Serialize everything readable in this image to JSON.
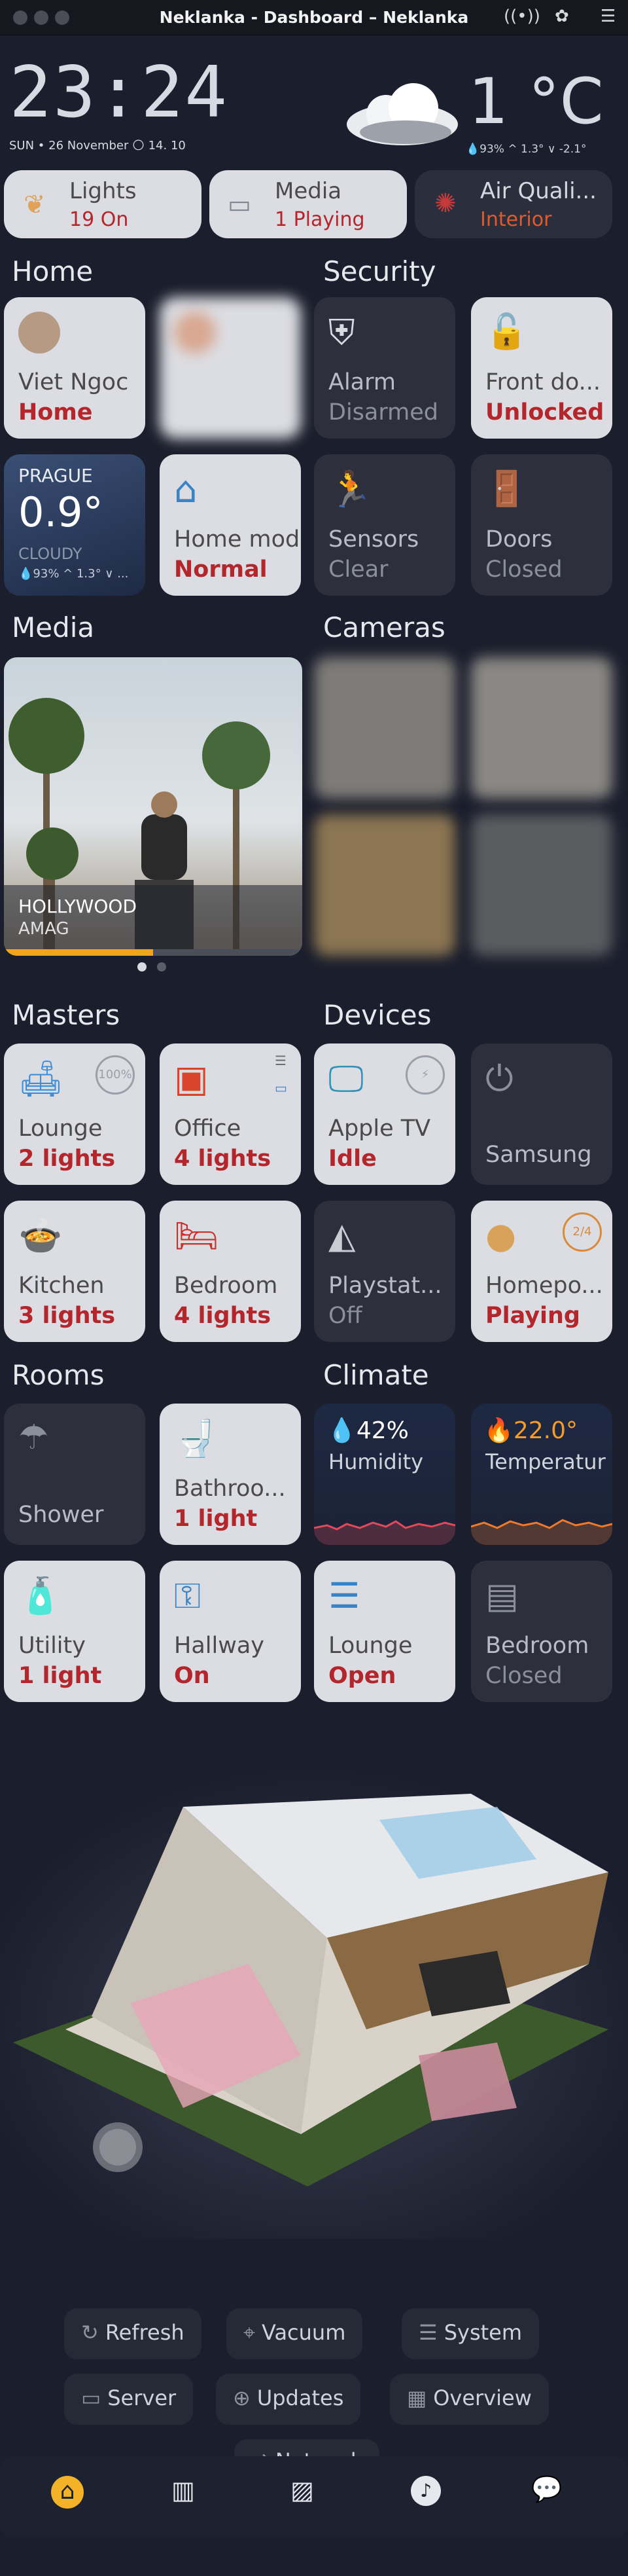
{
  "window": {
    "title": "Neklanka - Dashboard – Neklanka"
  },
  "header": {
    "time": "23:24",
    "date": "SUN • 26 November 🌕 14. 10",
    "temperature": "1 °C",
    "temp_details": "💧93% ^ 1.3° ∨ -2.1°"
  },
  "top_pills": [
    {
      "label": "Lights",
      "status": "19 On"
    },
    {
      "label": "Media",
      "status": "1 Playing"
    },
    {
      "label": "Air Quali...",
      "status": "Interior"
    }
  ],
  "sections": {
    "home": "Home",
    "security": "Security",
    "media": "Media",
    "cameras": "Cameras",
    "masters": "Masters",
    "devices": "Devices",
    "rooms": "Rooms",
    "climate": "Climate"
  },
  "home_cards": {
    "person1_name": "Viet Ngoc",
    "person1_state": "Home",
    "weather_city": "PRAGUE",
    "weather_temp": "0.9°",
    "weather_cond": "CLOUDY",
    "weather_details": "💧93% ^ 1.3° ∨ ...",
    "home_mode_name": "Home mode",
    "home_mode_state": "Normal"
  },
  "security_cards": [
    {
      "name": "Alarm",
      "state": "Disarmed"
    },
    {
      "name": "Front do...",
      "state": "Unlocked"
    },
    {
      "name": "Sensors",
      "state": "Clear"
    },
    {
      "name": "Doors",
      "state": "Closed"
    }
  ],
  "media_player": {
    "title": "HOLLYWOOD",
    "artist": "AMAG",
    "progress": 0.5
  },
  "masters": [
    {
      "name": "Lounge",
      "state": "2 lights",
      "badge": "100%"
    },
    {
      "name": "Office",
      "state": "4 lights"
    },
    {
      "name": "Kitchen",
      "state": "3 lights"
    },
    {
      "name": "Bedroom",
      "state": "4 lights"
    }
  ],
  "devices": [
    {
      "name": "Apple TV",
      "state": "Idle"
    },
    {
      "name": "Samsung",
      "state": ""
    },
    {
      "name": "Playstat...",
      "state": "Off"
    },
    {
      "name": "Homepo...",
      "state": "Playing",
      "badge": "2/4"
    }
  ],
  "rooms": [
    {
      "name": "Shower",
      "state": ""
    },
    {
      "name": "Bathroo...",
      "state": "1 light"
    },
    {
      "name": "Utility",
      "state": "1 light"
    },
    {
      "name": "Hallway",
      "state": "On"
    }
  ],
  "climate": {
    "humidity_value": "💧42%",
    "humidity_label": "Humidity",
    "temperature_value": "🔥22.0°",
    "temperature_label": "Temperatur",
    "cover1_name": "Lounge",
    "cover1_state": "Open",
    "cover2_name": "Bedroom",
    "cover2_state": "Closed"
  },
  "actions": {
    "refresh": "Refresh",
    "vacuum": "Vacuum",
    "system": "System",
    "server": "Server",
    "updates": "Updates",
    "overview": "Overview",
    "network": "Network"
  },
  "nav": [
    "home-icon",
    "chart-icon",
    "map-icon",
    "music-icon",
    "chat-icon"
  ]
}
